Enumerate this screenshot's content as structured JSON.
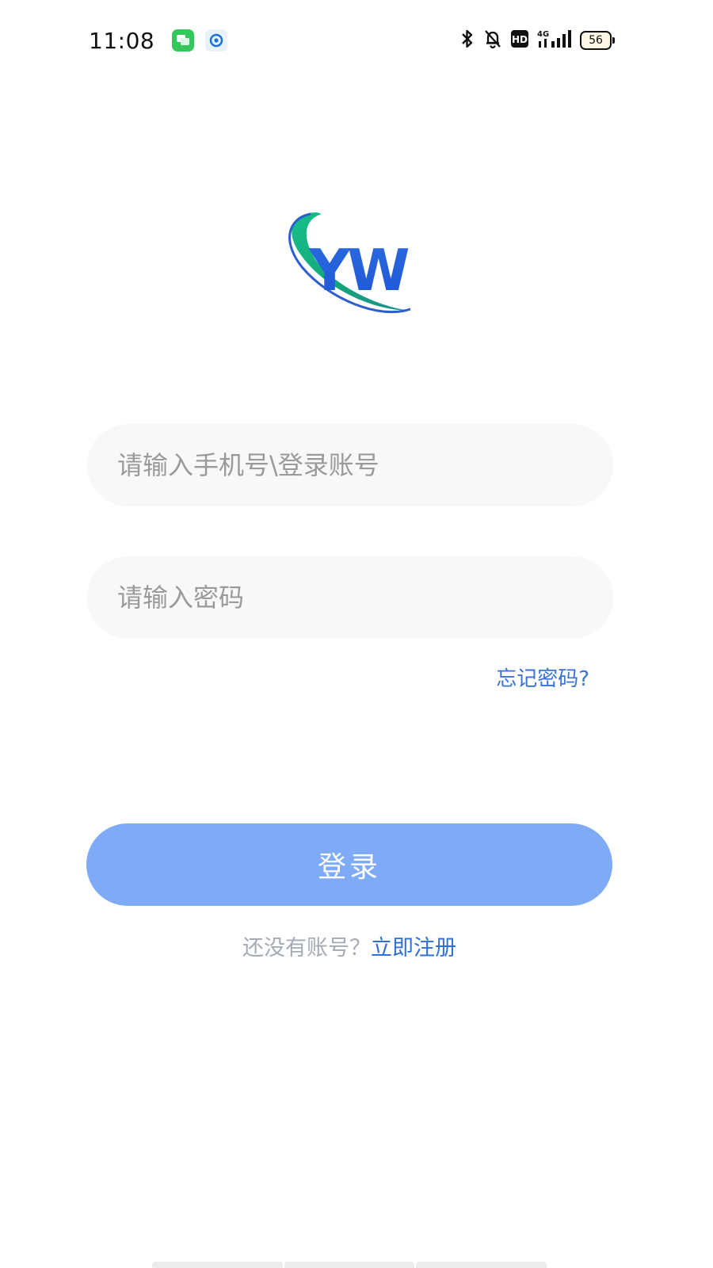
{
  "status_bar": {
    "time": "11:08",
    "battery": "56",
    "network": "4G",
    "hd_label": "HD"
  },
  "logo": {
    "text": "YW"
  },
  "login": {
    "account_placeholder": "请输入手机号\\登录账号",
    "password_placeholder": "请输入密码",
    "forgot_password": "忘记密码?",
    "login_button": "登录",
    "register_hint": "还没有账号？",
    "register_link": "立即注册"
  },
  "colors": {
    "primary_button": "#7eaaf6",
    "link": "#2f6fd6",
    "field_bg": "#f8f8f8"
  }
}
